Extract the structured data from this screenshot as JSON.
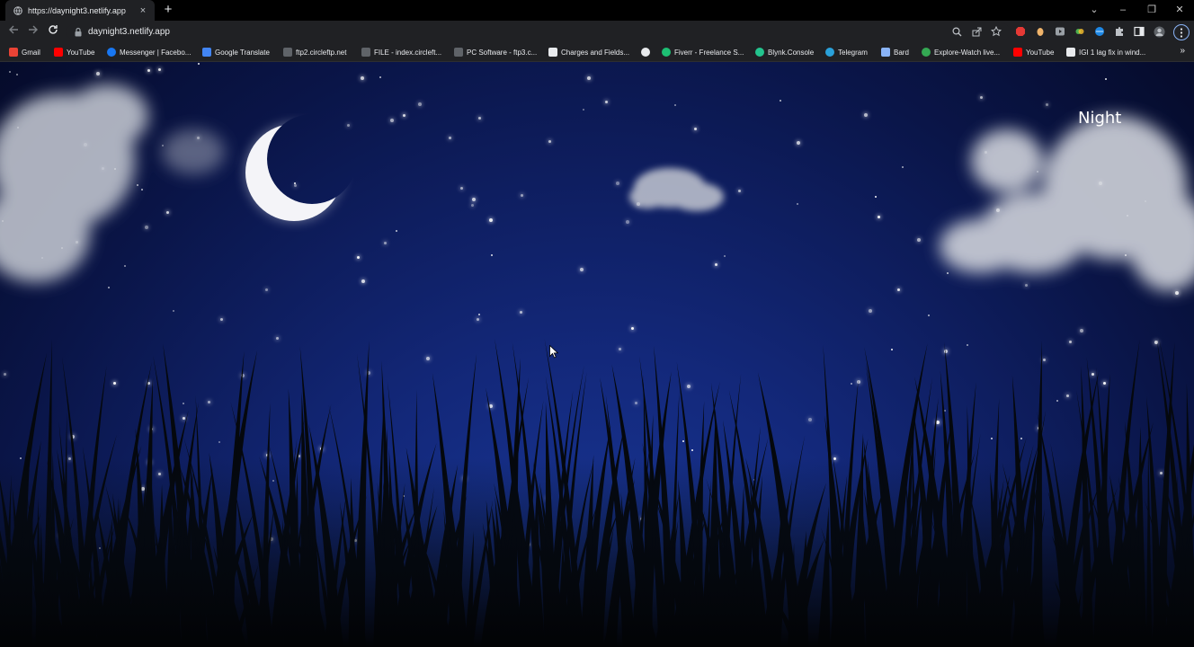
{
  "browser": {
    "tab_title": "https://daynight3.netlify.app",
    "url": "daynight3.netlify.app",
    "new_tab": "+",
    "close_tab": "×",
    "window_controls": [
      "⌄",
      "–",
      "❐",
      "✕"
    ]
  },
  "bookmarks": [
    {
      "label": "Gmail",
      "color": "#ea4335"
    },
    {
      "label": "YouTube",
      "color": "#ff0000"
    },
    {
      "label": "Messenger | Facebo...",
      "color": "#1877f2"
    },
    {
      "label": "Google Translate",
      "color": "#4285f4"
    },
    {
      "label": "ftp2.circleftp.net",
      "color": "#5f6368"
    },
    {
      "label": "FILE - index.circleft...",
      "color": "#5f6368"
    },
    {
      "label": "PC Software - ftp3.c...",
      "color": "#5f6368"
    },
    {
      "label": "Charges and Fields...",
      "color": "#e8eaed"
    },
    {
      "label": "",
      "color": "#e8eaed"
    },
    {
      "label": "Fiverr - Freelance S...",
      "color": "#1dbf73"
    },
    {
      "label": "Blynk.Console",
      "color": "#23c48e"
    },
    {
      "label": "Telegram",
      "color": "#2aa1da"
    },
    {
      "label": "Bard",
      "color": "#8ab4f8"
    },
    {
      "label": "Explore-Watch live...",
      "color": "#34a853"
    },
    {
      "label": "YouTube",
      "color": "#ff0000"
    },
    {
      "label": "IGI 1 lag fix in wind...",
      "color": "#e8eaed"
    }
  ],
  "bookmarks_more": "»",
  "page": {
    "mode_label": "Night"
  },
  "colors": {
    "sky_top": "#050b2a",
    "sky_bottom": "#1c3fa8",
    "grass": "#05080d"
  }
}
